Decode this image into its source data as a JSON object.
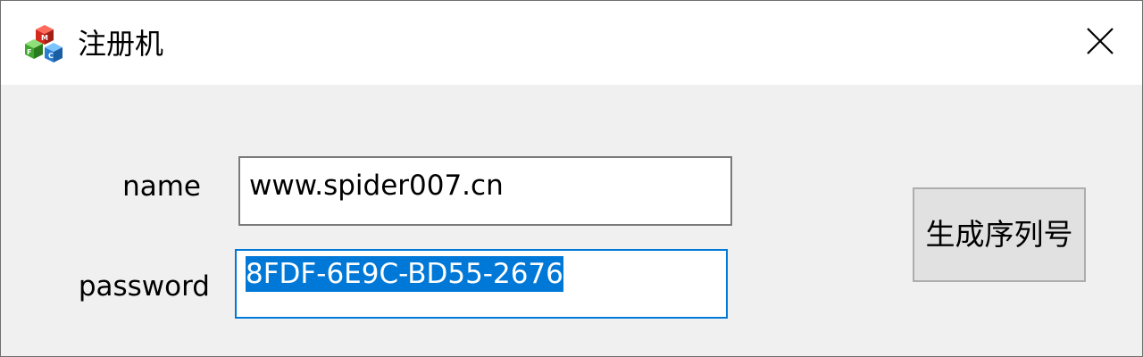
{
  "window": {
    "title": "注册机",
    "app_icon": "mfc-app-icon",
    "close_icon": "close-icon"
  },
  "form": {
    "name_label": "name",
    "name_value": "www.spider007.cn",
    "password_label": "password",
    "password_value": "8FDF-6E9C-BD55-2676",
    "password_selected": true,
    "generate_button": "生成序列号"
  },
  "colors": {
    "selection": "#0078d7",
    "focus_border": "#0078d7",
    "client_bg": "#f0f0f0",
    "button_bg": "#e1e1e1"
  }
}
